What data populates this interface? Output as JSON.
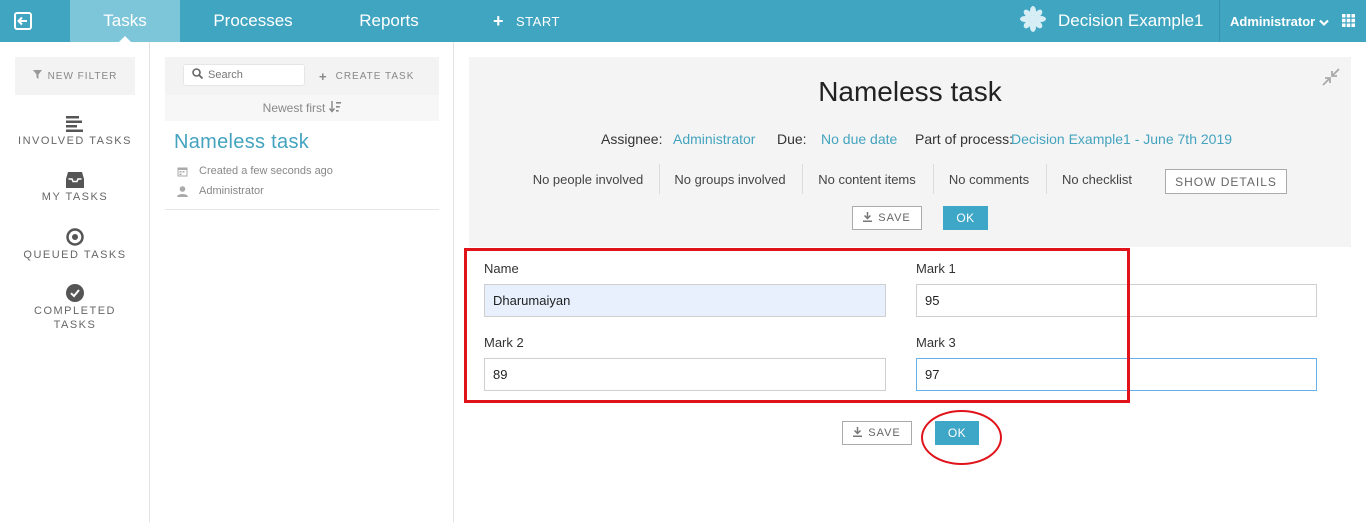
{
  "nav": {
    "tabs": [
      "Tasks",
      "Processes",
      "Reports"
    ],
    "start_label": "START",
    "app_name": "Decision Example1",
    "user": "Administrator"
  },
  "sidebar": {
    "new_filter": "NEW FILTER",
    "items": [
      {
        "label": "INVOLVED TASKS",
        "icon": "list-icon"
      },
      {
        "label": "MY TASKS",
        "icon": "inbox-icon"
      },
      {
        "label": "QUEUED TASKS",
        "icon": "target-icon"
      },
      {
        "label": "COMPLETED",
        "label2": "TASKS",
        "icon": "check-circle-icon"
      }
    ]
  },
  "task_list": {
    "search_placeholder": "Search",
    "create_label": "CREATE TASK",
    "sort_label": "Newest first",
    "tasks": [
      {
        "title": "Nameless task",
        "created": "Created a few seconds ago",
        "assignee": "Administrator"
      }
    ]
  },
  "task_header": {
    "title": "Nameless task",
    "assignee_label": "Assignee:",
    "assignee": "Administrator",
    "due_label": "Due:",
    "due": "No due date",
    "process_label": "Part of process:",
    "process": "Decision Example1 - June 7th 2019",
    "stats": [
      "No people involved",
      "No groups involved",
      "No content items",
      "No comments",
      "No checklist"
    ],
    "show_details": "SHOW DETAILS",
    "save_label": "SAVE",
    "ok_label": "OK"
  },
  "form": {
    "fields": [
      {
        "label": "Name",
        "value": "Dharumaiyan"
      },
      {
        "label": "Mark 1",
        "value": "95"
      },
      {
        "label": "Mark 2",
        "value": "89"
      },
      {
        "label": "Mark 3",
        "value": "97"
      }
    ],
    "save_label": "SAVE",
    "ok_label": "OK"
  },
  "colors": {
    "accent": "#40a5c0",
    "link": "#44a3bf",
    "ok_button": "#3ea6c6",
    "annotation": "#e0131b"
  }
}
